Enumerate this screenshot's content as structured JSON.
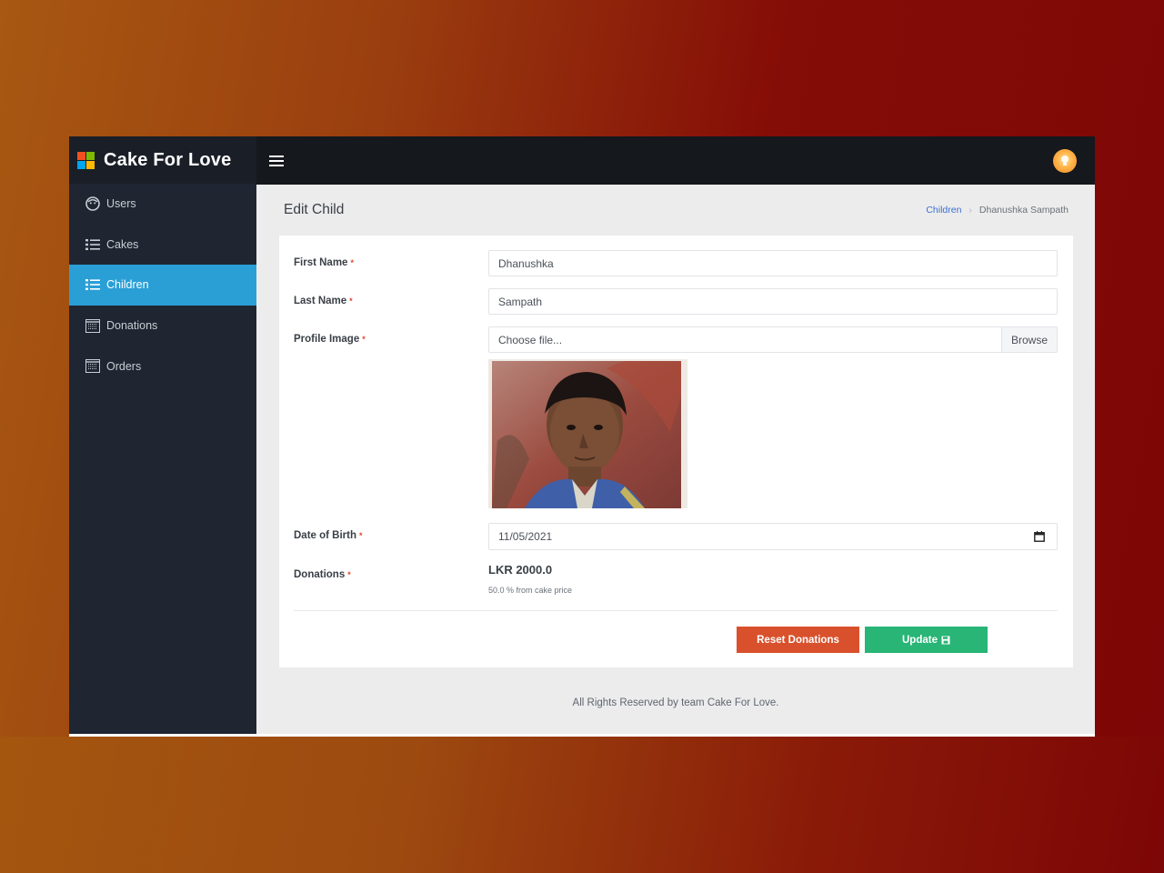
{
  "app": {
    "brand_name": "Cake For Love"
  },
  "sidebar": {
    "items": [
      {
        "label": "Users",
        "icon": "face-icon",
        "active": false
      },
      {
        "label": "Cakes",
        "icon": "list-icon",
        "active": false
      },
      {
        "label": "Children",
        "icon": "list-icon",
        "active": true
      },
      {
        "label": "Donations",
        "icon": "table-icon",
        "active": false
      },
      {
        "label": "Orders",
        "icon": "table-icon",
        "active": false
      }
    ]
  },
  "topbar": {
    "menu_icon": "hamburger-icon",
    "avatar_icon": "lightbulb-icon"
  },
  "page": {
    "title": "Edit Child",
    "breadcrumb": {
      "parent": "Children",
      "current": "Dhanushka Sampath"
    }
  },
  "form": {
    "first_name": {
      "label": "First Name",
      "value": "Dhanushka"
    },
    "last_name": {
      "label": "Last Name",
      "value": "Sampath"
    },
    "profile_image": {
      "label": "Profile Image",
      "placeholder": "Choose file...",
      "browse_label": "Browse"
    },
    "dob": {
      "label": "Date of Birth",
      "value": "11/05/2021"
    },
    "donations": {
      "label": "Donations",
      "value": "LKR 2000.0",
      "sub": "50.0 % from cake price"
    },
    "required_mark": "*",
    "reset_label": "Reset Donations",
    "update_label": "Update"
  },
  "footer": {
    "text": "All Rights Reserved by team Cake For Love."
  },
  "colors": {
    "accent": "#2a9fd6",
    "reset": "#d9512c",
    "update": "#28b576",
    "sidebar": "#1f2632",
    "topbar": "#15181d"
  }
}
